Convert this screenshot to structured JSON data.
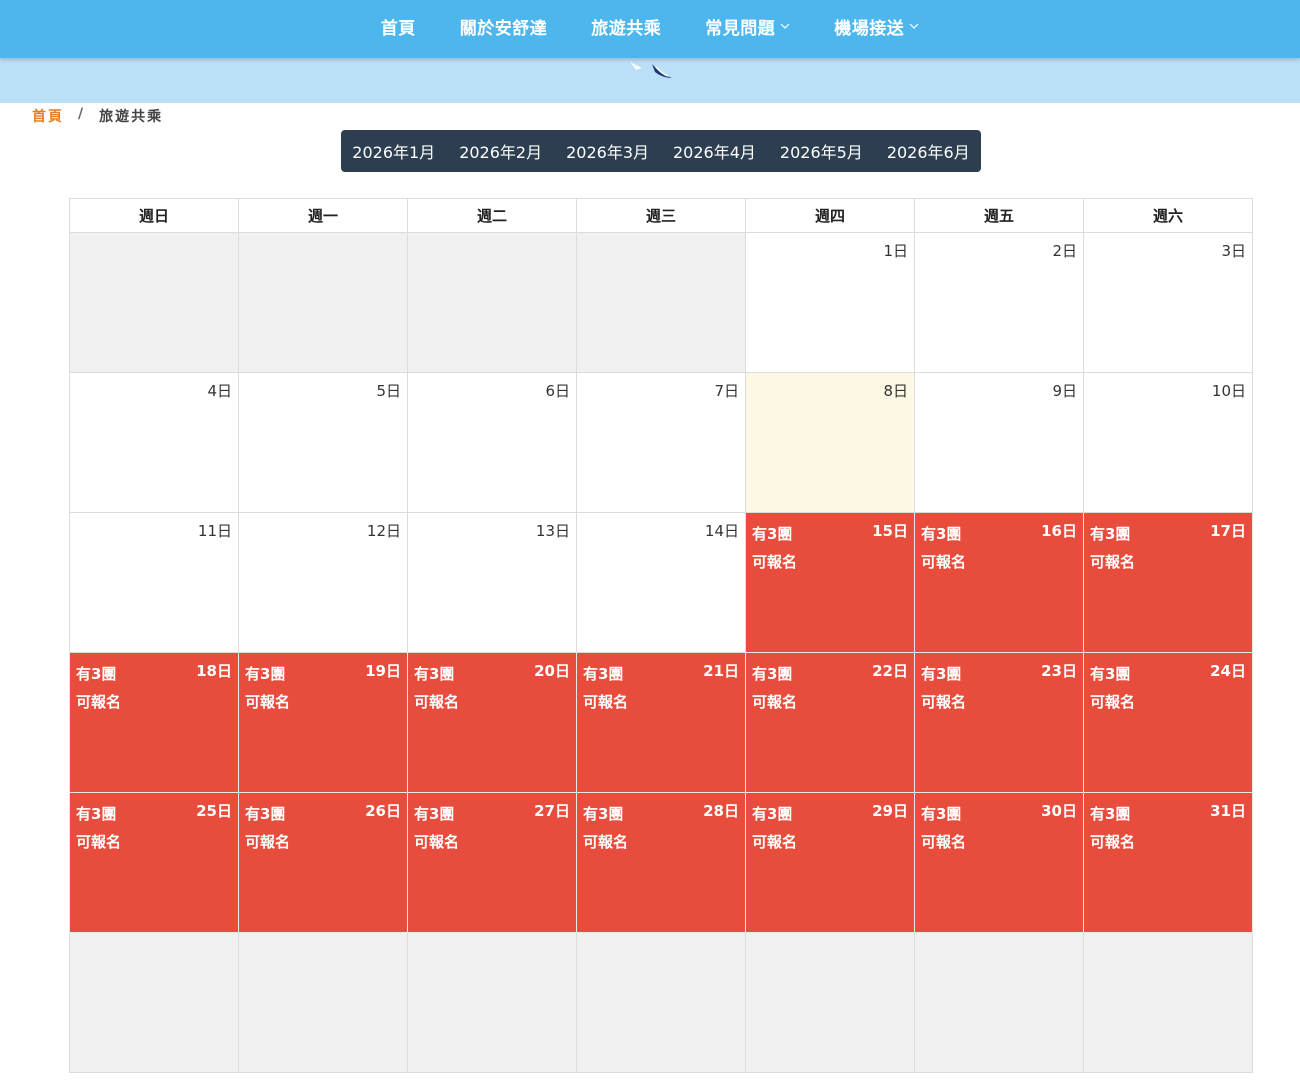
{
  "nav": {
    "items": [
      {
        "label": "首頁",
        "dropdown": false
      },
      {
        "label": "關於安舒達",
        "dropdown": false
      },
      {
        "label": "旅遊共乘",
        "dropdown": false
      },
      {
        "label": "常見問題",
        "dropdown": true
      },
      {
        "label": "機場接送",
        "dropdown": true
      }
    ]
  },
  "breadcrumb": {
    "home": "首頁",
    "separator": "/",
    "current": "旅遊共乘"
  },
  "month_tabs": [
    "2026年1月",
    "2026年2月",
    "2026年3月",
    "2026年4月",
    "2026年5月",
    "2026年6月"
  ],
  "calendar": {
    "weekdays": [
      "週日",
      "週一",
      "週二",
      "週三",
      "週四",
      "週五",
      "週六"
    ],
    "today": "8日",
    "avail_line1": "有3團",
    "avail_line2": "可報名",
    "weeks": [
      [
        null,
        null,
        null,
        null,
        {
          "day": "1日"
        },
        {
          "day": "2日"
        },
        {
          "day": "3日"
        }
      ],
      [
        {
          "day": "4日"
        },
        {
          "day": "5日"
        },
        {
          "day": "6日"
        },
        {
          "day": "7日"
        },
        {
          "day": "8日",
          "today": true
        },
        {
          "day": "9日"
        },
        {
          "day": "10日"
        }
      ],
      [
        {
          "day": "11日"
        },
        {
          "day": "12日"
        },
        {
          "day": "13日"
        },
        {
          "day": "14日"
        },
        {
          "day": "15日",
          "avail": true
        },
        {
          "day": "16日",
          "avail": true
        },
        {
          "day": "17日",
          "avail": true
        }
      ],
      [
        {
          "day": "18日",
          "avail": true
        },
        {
          "day": "19日",
          "avail": true
        },
        {
          "day": "20日",
          "avail": true
        },
        {
          "day": "21日",
          "avail": true
        },
        {
          "day": "22日",
          "avail": true
        },
        {
          "day": "23日",
          "avail": true
        },
        {
          "day": "24日",
          "avail": true
        }
      ],
      [
        {
          "day": "25日",
          "avail": true
        },
        {
          "day": "26日",
          "avail": true
        },
        {
          "day": "27日",
          "avail": true
        },
        {
          "day": "28日",
          "avail": true
        },
        {
          "day": "29日",
          "avail": true
        },
        {
          "day": "30日",
          "avail": true
        },
        {
          "day": "31日",
          "avail": true
        }
      ],
      [
        null,
        null,
        null,
        null,
        null,
        null,
        null
      ]
    ]
  },
  "colors": {
    "nav_bg": "#4db6ec",
    "banner_bg": "#bcdff8",
    "month_tabs_bg": "#2c3e50",
    "available": "#e74c3c",
    "today": "#fdf8e3",
    "empty": "#f0f0f0",
    "breadcrumb_home": "#e67e22"
  }
}
